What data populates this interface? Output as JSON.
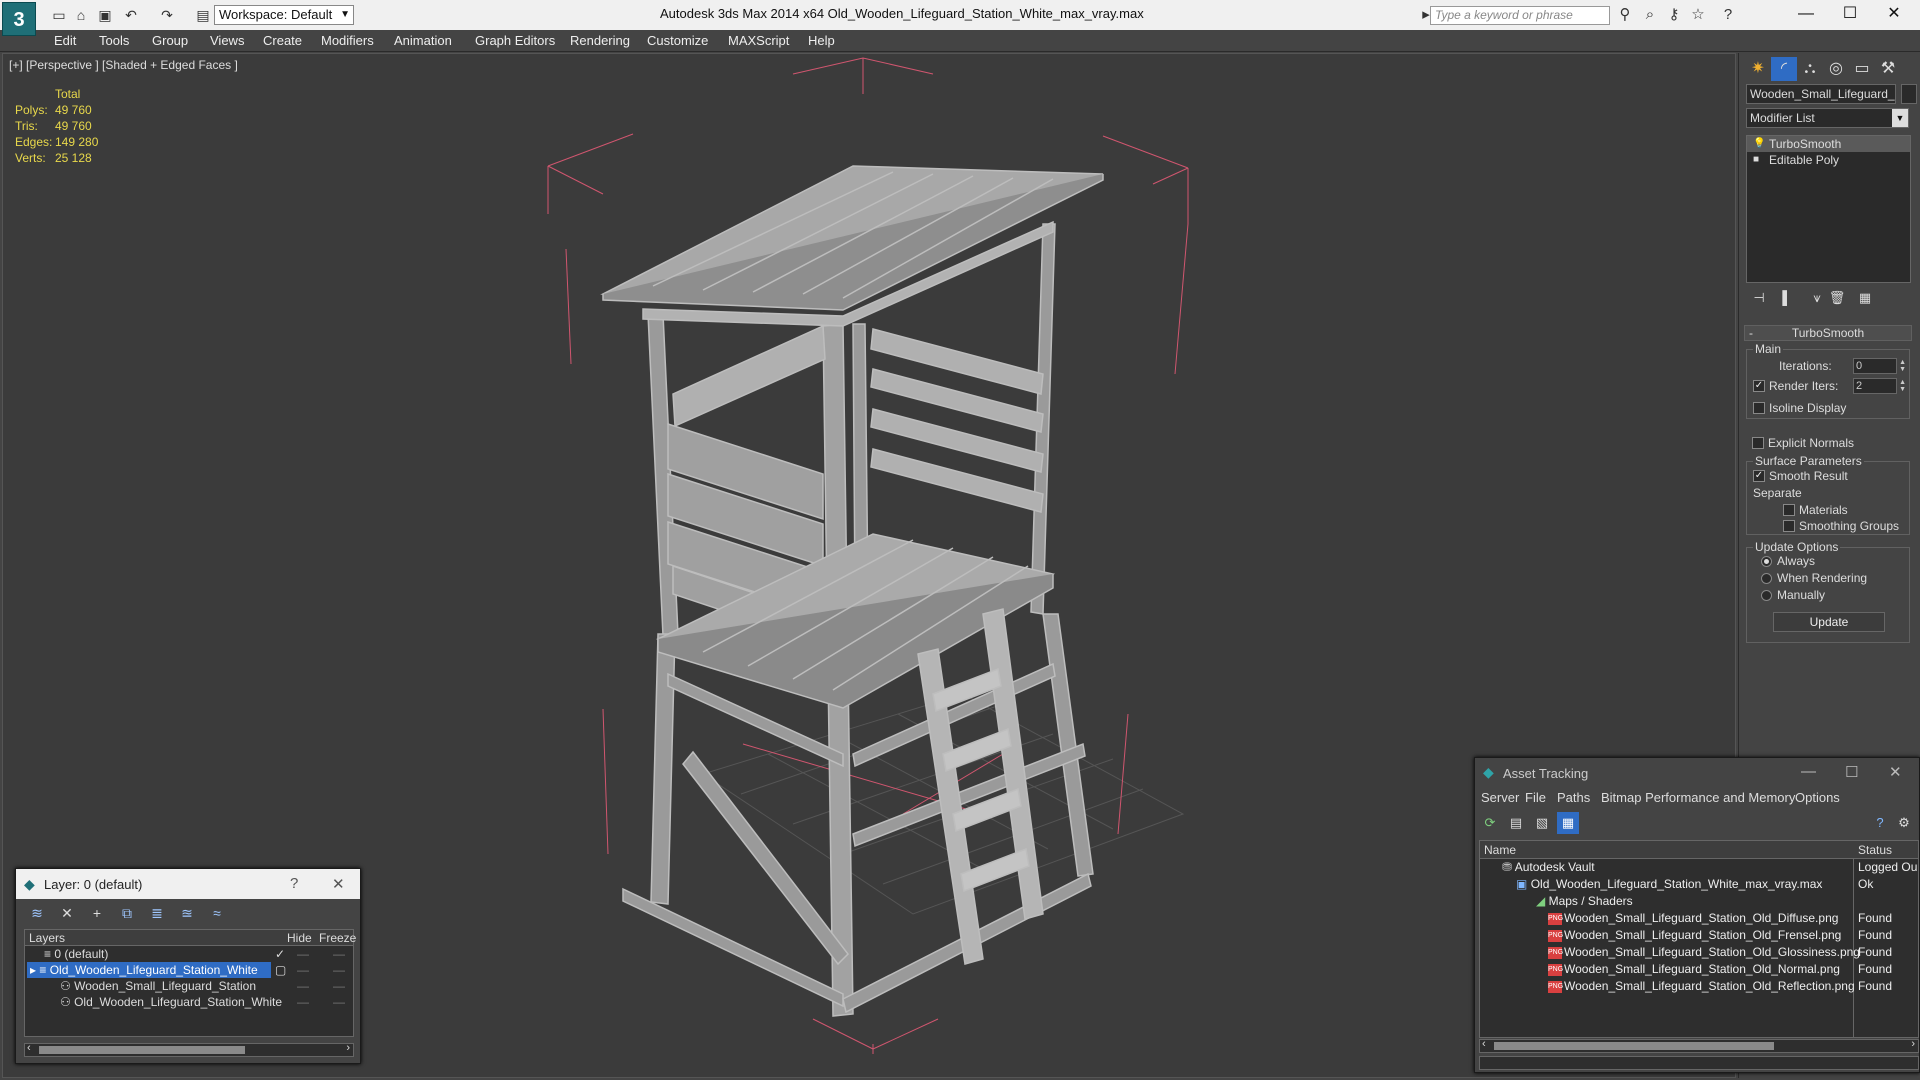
{
  "app": {
    "logo": "3",
    "window_title": "Autodesk 3ds Max  2014 x64       Old_Wooden_Lifeguard_Station_White_max_vray.max",
    "workspace": "Workspace: Default",
    "search_placeholder": "Type a keyword or phrase"
  },
  "menu": [
    "Edit",
    "Tools",
    "Group",
    "Views",
    "Create",
    "Modifiers",
    "Animation",
    "Graph Editors",
    "Rendering",
    "Customize",
    "MAXScript",
    "Help"
  ],
  "viewport": {
    "label": "[+] [Perspective ] [Shaded + Edged Faces ]",
    "stats": {
      "header": "Total",
      "rows": [
        {
          "k": "Polys:",
          "v": "49 760"
        },
        {
          "k": "Tris:",
          "v": "49 760"
        },
        {
          "k": "Edges:",
          "v": "149 280"
        },
        {
          "k": "Verts:",
          "v": "25 128"
        }
      ]
    }
  },
  "command_panel": {
    "object_name": "Wooden_Small_Lifeguard_Sta",
    "modifier_list": "Modifier List",
    "stack": [
      "TurboSmooth",
      "Editable Poly"
    ],
    "rollout_title": "TurboSmooth",
    "main_group": "Main",
    "iterations_label": "Iterations:",
    "iterations_value": "0",
    "render_iters_label": "Render Iters:",
    "render_iters_value": "2",
    "isoline_label": "Isoline Display",
    "explicit_normals_label": "Explicit Normals",
    "surface_group": "Surface Parameters",
    "smooth_result_label": "Smooth Result",
    "separate_label": "Separate",
    "materials_label": "Materials",
    "smoothing_groups_label": "Smoothing Groups",
    "update_group": "Update Options",
    "always_label": "Always",
    "when_rendering_label": "When Rendering",
    "manually_label": "Manually",
    "update_button": "Update"
  },
  "layer_window": {
    "title": "Layer: 0 (default)",
    "help": "?",
    "close": "✕",
    "columns": {
      "layers": "Layers",
      "hide": "Hide",
      "freeze": "Freeze"
    },
    "rows": [
      {
        "name": "0 (default)",
        "indent": 1,
        "check": "✓",
        "sel": false
      },
      {
        "name": "Old_Wooden_Lifeguard_Station_White",
        "indent": 1,
        "check": "",
        "sel": true
      },
      {
        "name": "Wooden_Small_Lifeguard_Station",
        "indent": 2,
        "check": "",
        "sel": false
      },
      {
        "name": "Old_Wooden_Lifeguard_Station_White",
        "indent": 2,
        "check": "",
        "sel": false
      }
    ]
  },
  "asset_window": {
    "title": "Asset Tracking",
    "menu": [
      "Server",
      "File",
      "Paths",
      "Bitmap Performance and Memory",
      "Options"
    ],
    "columns": {
      "name": "Name",
      "status": "Status"
    },
    "rows": [
      {
        "name": "Autodesk Vault",
        "status": "Logged Ou",
        "indent": 0,
        "icon": "vault"
      },
      {
        "name": "Old_Wooden_Lifeguard_Station_White_max_vray.max",
        "status": "Ok",
        "indent": 1,
        "icon": "max"
      },
      {
        "name": "Maps / Shaders",
        "status": "",
        "indent": 2,
        "icon": "maps"
      },
      {
        "name": "Wooden_Small_Lifeguard_Station_Old_Diffuse.png",
        "status": "Found",
        "indent": 3,
        "icon": "png"
      },
      {
        "name": "Wooden_Small_Lifeguard_Station_Old_Frensel.png",
        "status": "Found",
        "indent": 3,
        "icon": "png"
      },
      {
        "name": "Wooden_Small_Lifeguard_Station_Old_Glossiness.png",
        "status": "Found",
        "indent": 3,
        "icon": "png"
      },
      {
        "name": "Wooden_Small_Lifeguard_Station_Old_Normal.png",
        "status": "Found",
        "indent": 3,
        "icon": "png"
      },
      {
        "name": "Wooden_Small_Lifeguard_Station_Old_Reflection.png",
        "status": "Found",
        "indent": 3,
        "icon": "png"
      }
    ]
  },
  "colors": {
    "stats_text": "#e8d84b",
    "selection_blue": "#2f6cc4",
    "bounding_box": "#d0566f",
    "viewport_bg": "#3b3b3b"
  }
}
